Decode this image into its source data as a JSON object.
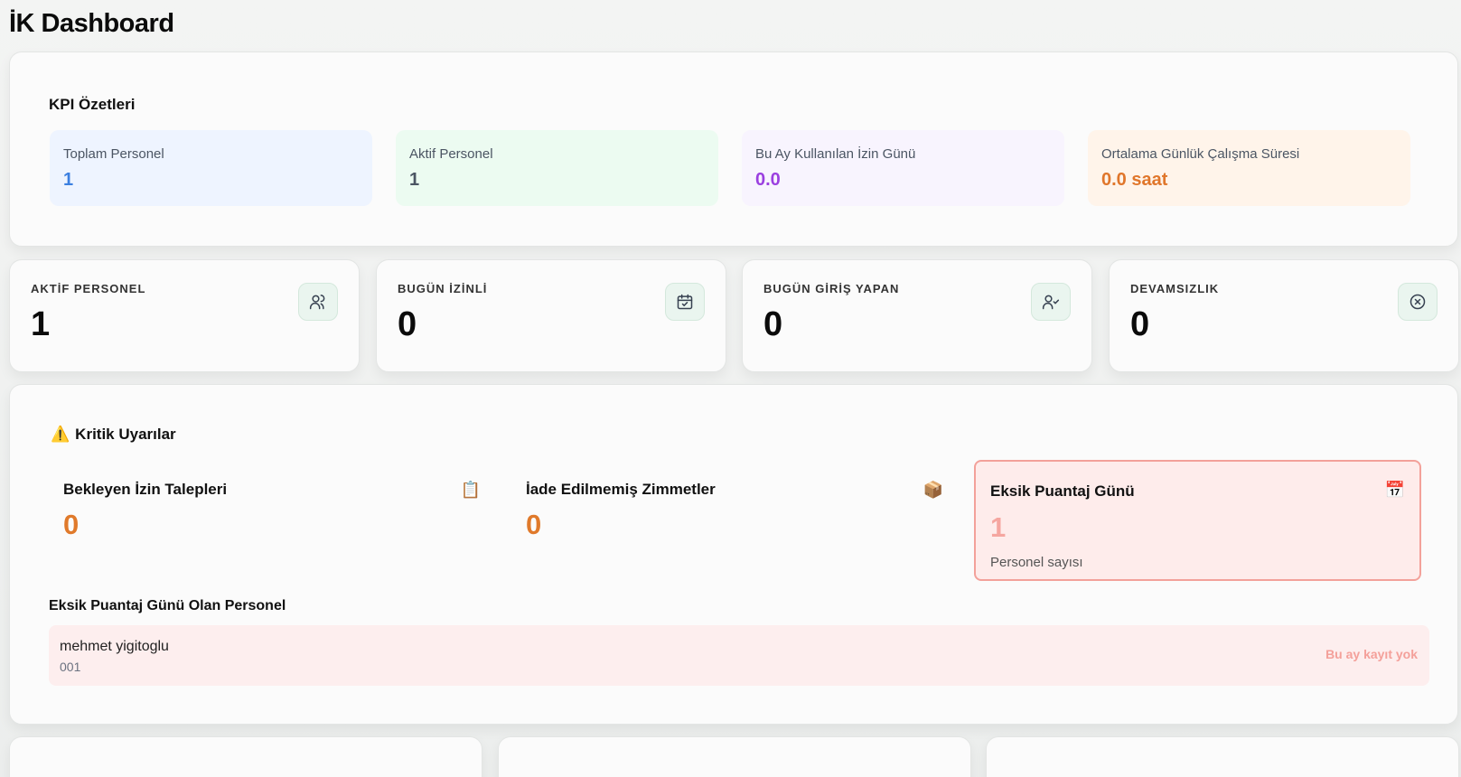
{
  "page": {
    "title": "İK Dashboard"
  },
  "kpi": {
    "heading": "KPI Özetleri",
    "tiles": [
      {
        "label": "Toplam Personel",
        "value": "1",
        "color": "#3b7fe0"
      },
      {
        "label": "Aktif Personel",
        "value": "1",
        "color": "#4b5563"
      },
      {
        "label": "Bu Ay Kullanılan İzin Günü",
        "value": "0.0",
        "color": "#9b3fe0"
      },
      {
        "label": "Ortalama Günlük Çalışma Süresi",
        "value": "0.0 saat",
        "color": "#e0762b"
      }
    ]
  },
  "stats": [
    {
      "label": "AKTİF PERSONEL",
      "value": "1",
      "icon": "users-icon"
    },
    {
      "label": "BUGÜN İZİNLİ",
      "value": "0",
      "icon": "calendar-check-icon"
    },
    {
      "label": "BUGÜN GİRİŞ YAPAN",
      "value": "0",
      "icon": "user-check-icon"
    },
    {
      "label": "DEVAMSIZLIK",
      "value": "0",
      "icon": "x-circle-icon"
    }
  ],
  "alerts": {
    "heading": "Kritik Uyarılar",
    "heading_icon": "⚠️",
    "items": [
      {
        "title": "Bekleyen İzin Talepleri",
        "value": "0",
        "icon": "📋"
      },
      {
        "title": "İade Edilmemiş Zimmetler",
        "value": "0",
        "icon": "📦"
      },
      {
        "title": "Eksik Puantaj Günü",
        "value": "1",
        "icon": "📅",
        "subtitle": "Personel sayısı"
      }
    ],
    "missing_heading": "Eksik Puantaj Günü Olan Personel",
    "missing_list": [
      {
        "name": "mehmet yigitoglu",
        "code": "001",
        "status": "Bu ay kayıt yok"
      }
    ]
  }
}
